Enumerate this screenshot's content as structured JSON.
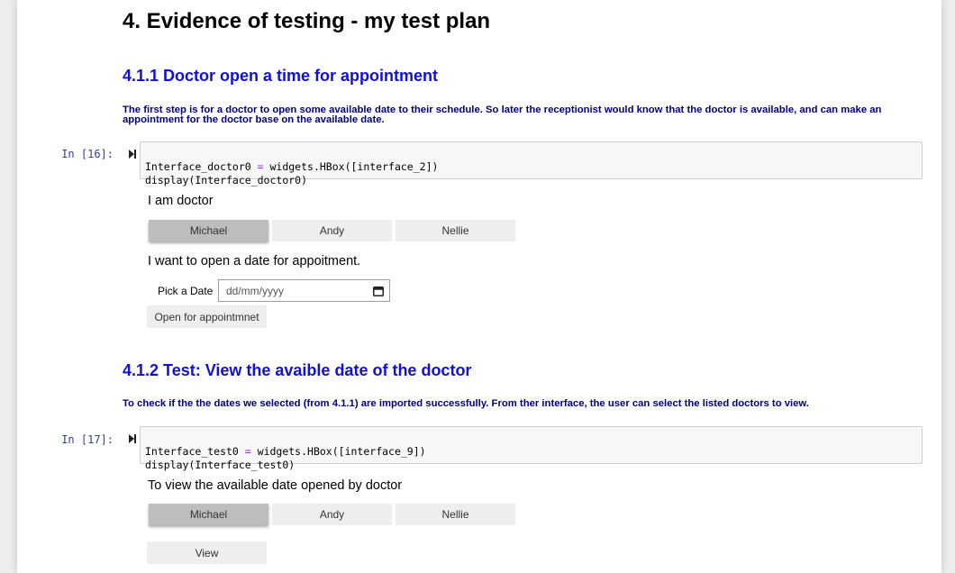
{
  "title": "4. Evidence of testing - my test plan",
  "section1": {
    "heading": "4.1.1 Doctor open a time for appointment",
    "description": "The first step is for a doctor to open some available date to their schedule. So later the receptionist would know that the doctor is available, and can make an appointment for the doctor base on the available date.",
    "prompt": "In [16]:",
    "code_line1_a": "Interface_doctor0 ",
    "code_line1_op": "=",
    "code_line1_b": " widgets.HBox([interface_2])",
    "code_line2": "display(Interface_doctor0)",
    "widget_label": "I am doctor",
    "toggle_buttons": [
      "Michael",
      "Andy",
      "Nellie"
    ],
    "active_toggle": "Michael",
    "prompt_text": "I want to open a date for appoitment.",
    "date_label": "Pick a Date",
    "date_placeholder": "dd/mm/yyyy",
    "submit_button": "Open for appointmnet"
  },
  "section2": {
    "heading": "4.1.2 Test: View the avaible date of the doctor",
    "description": "To check if the the dates we selected (from 4.1.1) are imported successfully. From ther interface, the user can select the listed doctors to view.",
    "prompt": "In [17]:",
    "code_line1_a": "Interface_test0 ",
    "code_line1_op": "=",
    "code_line1_b": " widgets.HBox([interface_9])",
    "code_line2": "display(Interface_test0)",
    "widget_label": "To view the available date opened by doctor",
    "toggle_buttons": [
      "Michael",
      "Andy",
      "Nellie"
    ],
    "active_toggle": "Michael",
    "view_button": "View"
  },
  "icons": {
    "run": "run-cell-icon",
    "calendar": "calendar-icon"
  }
}
